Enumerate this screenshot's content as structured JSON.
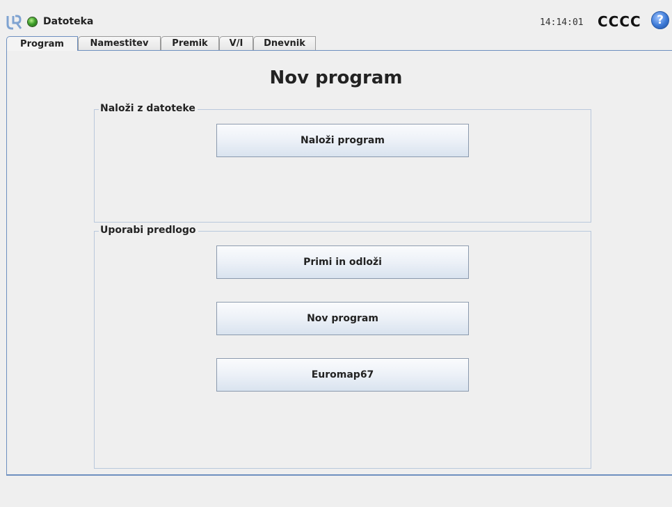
{
  "header": {
    "app_title": "Datoteka",
    "clock": "14:14:01",
    "robot_name": "CCCC",
    "help_label": "?",
    "status_color": "#3fa12b"
  },
  "tabs": [
    {
      "label": "Program",
      "active": true
    },
    {
      "label": "Namestitev",
      "active": false
    },
    {
      "label": "Premik",
      "active": false
    },
    {
      "label": "V/I",
      "active": false
    },
    {
      "label": "Dnevnik",
      "active": false
    }
  ],
  "main": {
    "title": "Nov program",
    "load_group": {
      "label": "Naloži z datoteke",
      "buttons": [
        "Naloži program"
      ]
    },
    "template_group": {
      "label": "Uporabi predlogo",
      "buttons": [
        "Primi in odloži",
        "Nov program",
        "Euromap67"
      ]
    }
  },
  "colors": {
    "accent": "#6d8fbf",
    "background": "#efefef"
  }
}
